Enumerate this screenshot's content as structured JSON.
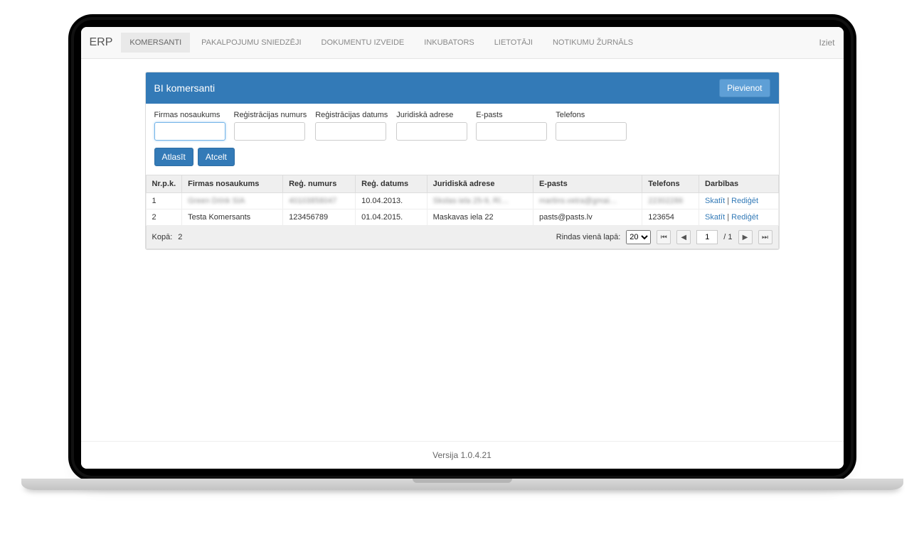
{
  "nav": {
    "brand": "ERP",
    "items": [
      "KOMERSANTI",
      "PAKALPOJUMU SNIEDZĒJI",
      "DOKUMENTU IZVEIDE",
      "INKUBATORS",
      "LIETOTĀJI",
      "NOTIKUMU ŽURNĀLS"
    ],
    "logout": "Iziet"
  },
  "panel": {
    "title": "BI komersanti",
    "add_button": "Pievienot"
  },
  "filters": {
    "labels": {
      "name": "Firmas nosaukums",
      "reg_no": "Reģistrācijas numurs",
      "reg_date": "Reģistrācijas datums",
      "address": "Juridiskā adrese",
      "email": "E-pasts",
      "phone": "Telefons"
    },
    "buttons": {
      "filter": "Atlasīt",
      "cancel": "Atcelt"
    }
  },
  "table": {
    "headers": {
      "nr": "Nr.p.k.",
      "name": "Firmas nosaukums",
      "reg_no": "Reģ. numurs",
      "reg_date": "Reģ. datums",
      "address": "Juridiskā adrese",
      "email": "E-pasts",
      "phone": "Telefons",
      "actions": "Darbības"
    },
    "rows": [
      {
        "nr": "1",
        "name": "Green Drink SIA",
        "reg_no": "40103858047",
        "reg_date": "10.04.2013.",
        "address": "Skolas iela 25-9, Rī…",
        "email": "martins.vetra@gmai…",
        "phone": "22302286"
      },
      {
        "nr": "2",
        "name": "Testa Komersants",
        "reg_no": "123456789",
        "reg_date": "01.04.2015.",
        "address": "Maskavas iela 22",
        "email": "pasts@pasts.lv",
        "phone": "123654"
      }
    ],
    "actions": {
      "view": "Skatīt",
      "edit": "Rediģēt"
    }
  },
  "pagination": {
    "total_label": "Kopā:",
    "total_value": "2",
    "rows_per_page_label": "Rindas vienā lapā:",
    "page_size": "20",
    "page_current": "1",
    "page_total": "/ 1"
  },
  "footer": {
    "version": "Versija 1.0.4.21"
  }
}
